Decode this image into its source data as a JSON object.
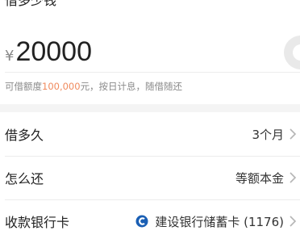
{
  "amount_section": {
    "title": "借多少钱",
    "currency_symbol": "¥",
    "amount_value": "20000",
    "hint_prefix": "可借额度",
    "hint_limit": "100,000",
    "hint_suffix": "元，按日计息，随借随还"
  },
  "rows": [
    {
      "label": "借多久",
      "value": "3个月"
    },
    {
      "label": "怎么还",
      "value": "等额本金"
    },
    {
      "label": "收款银行卡",
      "value": "建设银行储蓄卡 (1176)"
    }
  ],
  "colors": {
    "accent": "#f08a5d",
    "bank_logo": "#1a5fb4"
  }
}
